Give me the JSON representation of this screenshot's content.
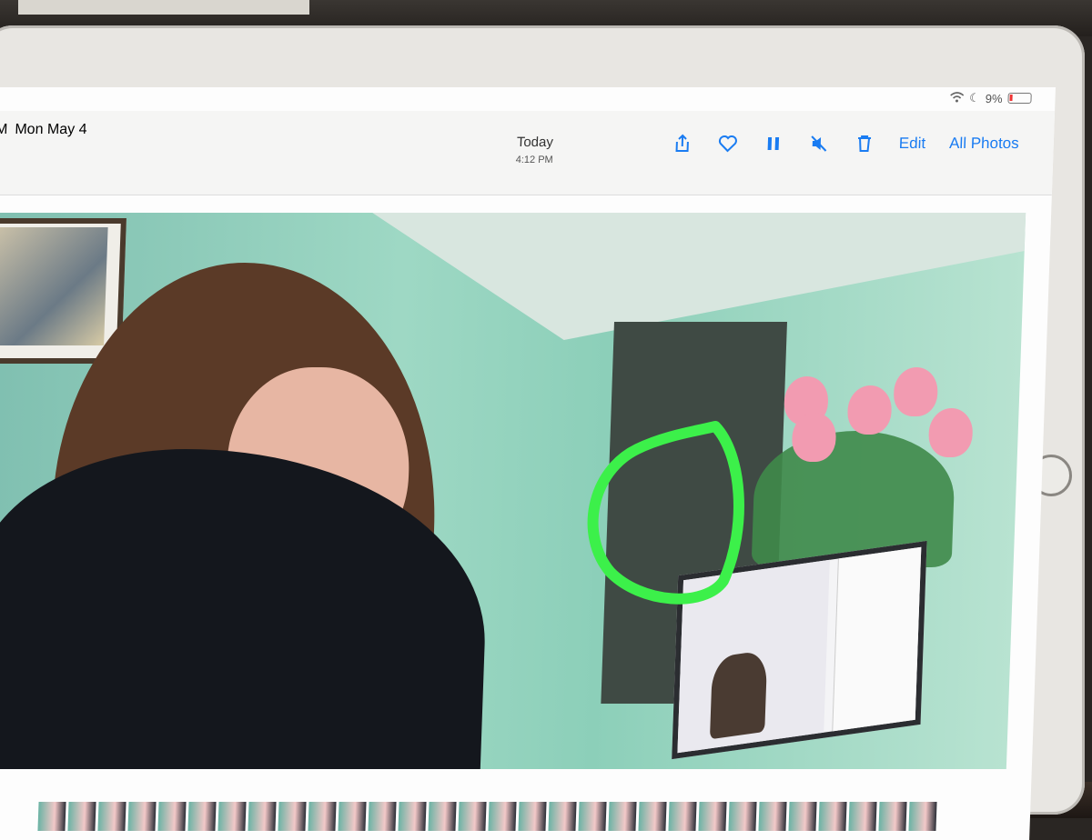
{
  "status_bar": {
    "time_fragment": "PM",
    "date": "Mon May 4",
    "battery": "9%"
  },
  "nav": {
    "title": "Today",
    "subtitle": "4:12 PM",
    "edit_label": "Edit",
    "all_photos_label": "All Photos",
    "icons": [
      "back-chevron-icon",
      "share-icon",
      "heart-icon",
      "pause-icon",
      "mute-icon",
      "trash-icon"
    ]
  },
  "colors": {
    "accent": "#1a7cf2",
    "annotation": "#3cf04a"
  },
  "filmstrip": {
    "thumbnail_count": 30
  }
}
